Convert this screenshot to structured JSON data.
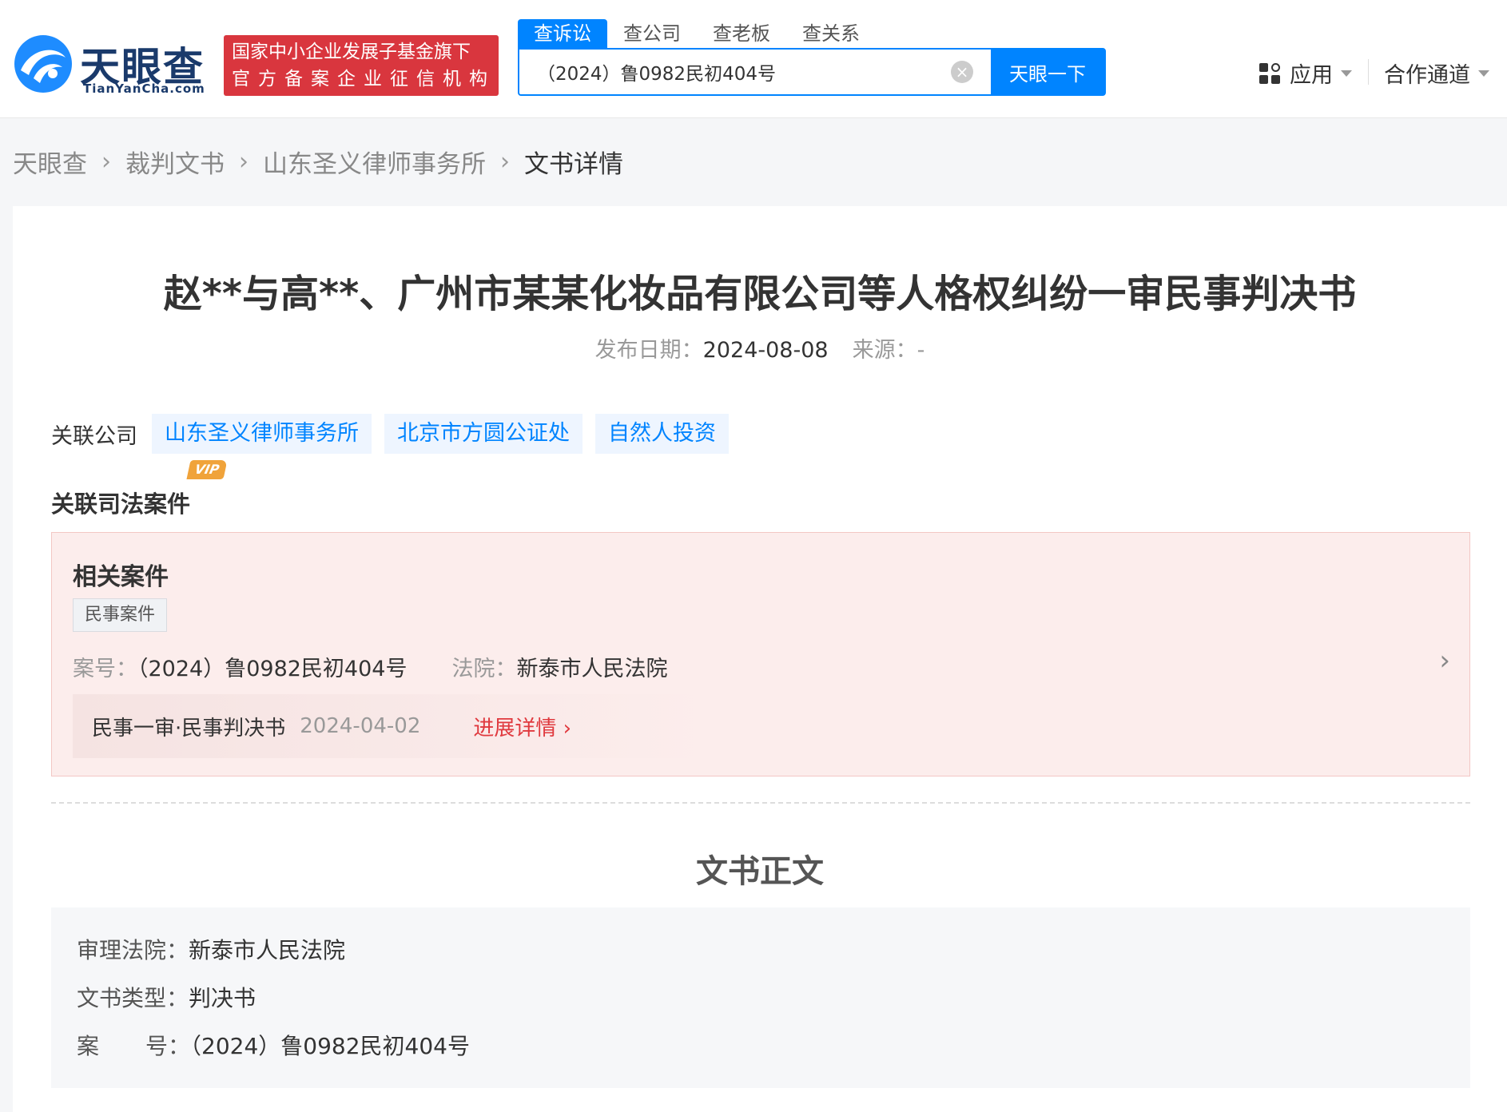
{
  "brand": {
    "logo_cn": "天眼查",
    "logo_en": "TianYanCha.com",
    "badge_line1": "国家中小企业发展子基金旗下",
    "badge_line2": "官方备案企业征信机构"
  },
  "search": {
    "tabs": [
      "查诉讼",
      "查公司",
      "查老板",
      "查关系"
    ],
    "value": "（2024）鲁0982民初404号",
    "button": "天眼一下"
  },
  "nav": {
    "apps": "应用",
    "cooperation": "合作通道"
  },
  "breadcrumb": [
    "天眼查",
    "裁判文书",
    "山东圣义律师事务所",
    "文书详情"
  ],
  "document": {
    "title": "赵**与高**、广州市某某化妆品有限公司等人格权纠纷一审民事判决书",
    "publish_label": "发布日期：",
    "publish_date": "2024-08-08",
    "source_label": "来源：",
    "source": "-"
  },
  "related_companies": {
    "label": "关联公司",
    "items": [
      "山东圣义律师事务所",
      "北京市方圆公证处",
      "自然人投资"
    ]
  },
  "judicial": {
    "title": "关联司法案件",
    "vip": "VIP",
    "case_title": "相关案件",
    "case_type": "民事案件",
    "case_no_label": "案号：",
    "case_no": "（2024）鲁0982民初404号",
    "court_label": "法院：",
    "court": "新泰市人民法院",
    "progress_name": "民事一审·民事判决书",
    "progress_date": "2024-04-02",
    "progress_link": "进展详情"
  },
  "body": {
    "title": "文书正文",
    "court_label": "审理法院：",
    "court": "新泰市人民法院",
    "type_label": "文书类型：",
    "type": "判决书",
    "case_no_label_a": "案",
    "case_no_label_b": "号：",
    "case_no": "（2024）鲁0982民初404号"
  }
}
